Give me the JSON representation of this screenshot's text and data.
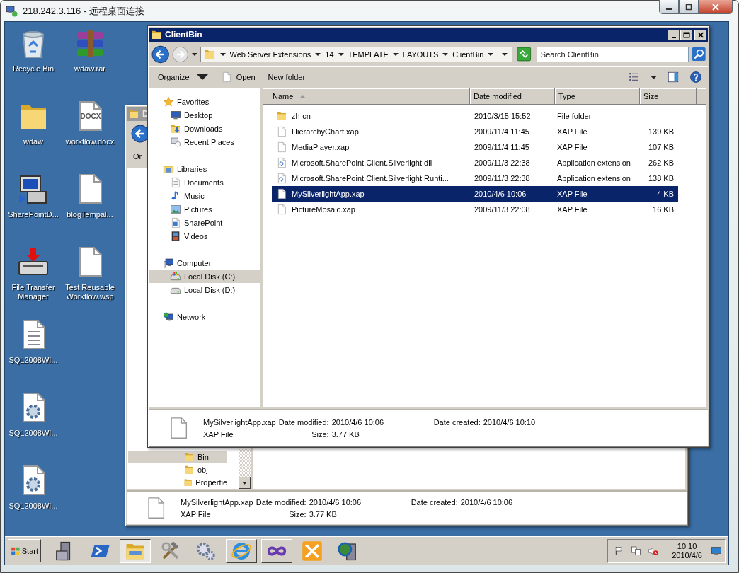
{
  "window": {
    "title": "218.242.3.116 - 远程桌面连接"
  },
  "desktop": {
    "columns": [
      [
        {
          "label": "Recycle Bin",
          "kind": "recycle"
        },
        {
          "label": "wdaw",
          "kind": "folder"
        },
        {
          "label": "SharePointD...",
          "kind": "setup"
        },
        {
          "label": "File Transfer Manager",
          "kind": "transfer"
        },
        {
          "label": "SQL2008WI...",
          "kind": "textfile"
        },
        {
          "label": "SQL2008WI...",
          "kind": "config"
        },
        {
          "label": "SQL2008WI...",
          "kind": "config"
        }
      ],
      [
        {
          "label": "wdaw.rar",
          "kind": "rar"
        },
        {
          "label": "workflow.docx",
          "kind": "docx",
          "badge": "DOCX"
        },
        {
          "label": "blogTempal...",
          "kind": "page"
        },
        {
          "label": "Test Reusable Workflow.wsp",
          "kind": "page"
        }
      ]
    ]
  },
  "background_window": {
    "title": "D",
    "toolbar_label": "Or",
    "nav": [
      {
        "label": "Bin",
        "selected": true
      },
      {
        "label": "obj",
        "selected": false
      },
      {
        "label": "Propertie",
        "selected": false
      }
    ],
    "details": {
      "name": "MySilverlightApp.xap",
      "type": "XAP File",
      "fields": [
        {
          "label": "Date modified:",
          "value": "2010/4/6 10:06"
        },
        {
          "label": "Size:",
          "value": "3.77 KB"
        },
        {
          "label": "Date created:",
          "value": "2010/4/6 10:06"
        }
      ]
    }
  },
  "explorer": {
    "title": "ClientBin",
    "breadcrumb": [
      "Web Server Extensions",
      "14",
      "TEMPLATE",
      "LAYOUTS",
      "ClientBin"
    ],
    "search": {
      "placeholder": "Search ClientBin"
    },
    "toolbar": [
      {
        "label": "Organize",
        "kind": "menu"
      },
      {
        "label": "Open",
        "kind": "open"
      },
      {
        "label": "New folder",
        "kind": "plain"
      }
    ],
    "nav": [
      {
        "label": "Favorites",
        "kind": "star",
        "selected": false,
        "children": [
          {
            "label": "Desktop",
            "kind": "monitor",
            "selected": false
          },
          {
            "label": "Downloads",
            "kind": "downloads",
            "selected": false
          },
          {
            "label": "Recent Places",
            "kind": "recent",
            "selected": false
          }
        ]
      },
      {
        "label": "Libraries",
        "kind": "library",
        "selected": false,
        "children": [
          {
            "label": "Documents",
            "kind": "documents",
            "selected": false
          },
          {
            "label": "Music",
            "kind": "music",
            "selected": false
          },
          {
            "label": "Pictures",
            "kind": "pictures",
            "selected": false
          },
          {
            "label": "SharePoint",
            "kind": "sharepoint",
            "selected": false
          },
          {
            "label": "Videos",
            "kind": "videos",
            "selected": false
          }
        ]
      },
      {
        "label": "Computer",
        "kind": "computer",
        "selected": false,
        "children": [
          {
            "label": "Local Disk (C:)",
            "kind": "diskc",
            "selected": true
          },
          {
            "label": "Local Disk (D:)",
            "kind": "disk",
            "selected": false
          }
        ]
      },
      {
        "label": "Network",
        "kind": "network",
        "selected": false
      }
    ],
    "columns": [
      {
        "label": "Name",
        "sorted": true
      },
      {
        "label": "Date modified",
        "sorted": false
      },
      {
        "label": "Type",
        "sorted": false
      },
      {
        "label": "Size",
        "sorted": false
      }
    ],
    "rows": [
      {
        "name": "zh-cn",
        "date": "2010/3/15 15:52",
        "type": "File folder",
        "kind": "folder",
        "selected": false
      },
      {
        "name": "HierarchyChart.xap",
        "date": "2009/11/4 11:45",
        "type": "XAP File",
        "size": "139 KB",
        "kind": "page",
        "selected": false
      },
      {
        "name": "MediaPlayer.xap",
        "date": "2009/11/4 11:45",
        "type": "XAP File",
        "size": "107 KB",
        "kind": "page",
        "selected": false
      },
      {
        "name": "Microsoft.SharePoint.Client.Silverlight.dll",
        "date": "2009/11/3 22:38",
        "type": "Application extension",
        "size": "262 KB",
        "kind": "dll",
        "selected": false
      },
      {
        "name": "Microsoft.SharePoint.Client.Silverlight.Runti...",
        "date": "2009/11/3 22:38",
        "type": "Application extension",
        "size": "138 KB",
        "kind": "dll",
        "selected": false
      },
      {
        "name": "MySilverlightApp.xap",
        "date": "2010/4/6 10:06",
        "type": "XAP File",
        "size": "4 KB",
        "kind": "page",
        "selected": true
      },
      {
        "name": "PictureMosaic.xap",
        "date": "2009/11/3 22:08",
        "type": "XAP File",
        "size": "16 KB",
        "kind": "page",
        "selected": false
      }
    ],
    "details": {
      "name": "MySilverlightApp.xap",
      "type": "XAP File",
      "fields": [
        {
          "label": "Date modified:",
          "value": "2010/4/6 10:06"
        },
        {
          "label": "Size:",
          "value": "3.77 KB"
        },
        {
          "label": "Date created:",
          "value": "2010/4/6 10:10"
        }
      ]
    }
  },
  "taskbar": {
    "start": "Start",
    "apps": [
      {
        "kind": "server",
        "active": false,
        "open": false
      },
      {
        "kind": "powershell",
        "active": false,
        "open": false
      },
      {
        "kind": "explorer",
        "active": true,
        "open": true
      },
      {
        "kind": "tools",
        "active": false,
        "open": false
      },
      {
        "kind": "gears",
        "active": false,
        "open": false
      },
      {
        "kind": "ie",
        "active": false,
        "open": true
      },
      {
        "kind": "vs",
        "active": false,
        "open": true
      },
      {
        "kind": "orangetools",
        "active": false,
        "open": false
      },
      {
        "kind": "globeserver",
        "active": false,
        "open": false
      }
    ],
    "tray": [
      {
        "kind": "flag"
      },
      {
        "kind": "net"
      },
      {
        "kind": "speaker"
      }
    ],
    "clock": {
      "time": "10:10",
      "date": "2010/4/6"
    },
    "tray_end": [
      {
        "kind": "display"
      }
    ]
  }
}
